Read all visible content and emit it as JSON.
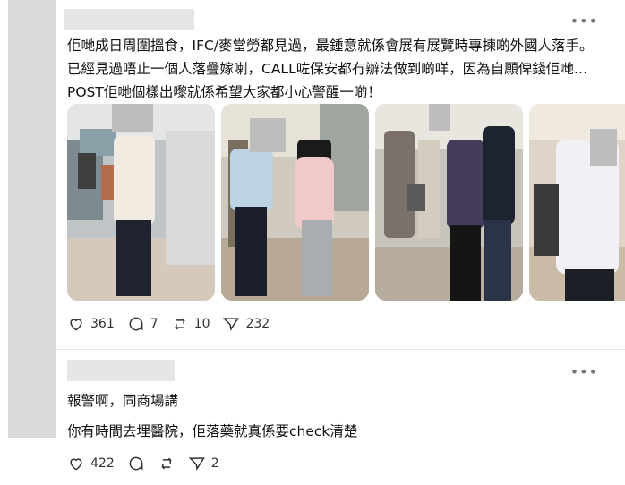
{
  "post": {
    "text": "佢哋成日周圍搵食，IFC/麥當勞都見過，最鍾意就係會展有展覽時專揀啲外國人落手。已經見過唔止一個人落疊嫁喇，CALL咗保安都冇辦法做到啲咩，因為自願俾錢佢哋…POST佢哋個樣出嚟就係希望大家都小心警醒一啲！",
    "stats": {
      "likes": "361",
      "comments": "7",
      "reposts": "10",
      "shares": "232"
    }
  },
  "reply": {
    "line1": "報警啊，同商場講",
    "line2": "你有時間去埋醫院，佢落藥就真係要check清楚",
    "stats": {
      "likes": "422",
      "shares": "2"
    }
  },
  "icons": [
    "heart-icon",
    "comment-icon",
    "repost-icon",
    "share-icon",
    "more-icon"
  ],
  "colors": {
    "background": "#ffffff",
    "text": "#101010",
    "muted": "#777777",
    "redaction": "#e6e6e6"
  }
}
